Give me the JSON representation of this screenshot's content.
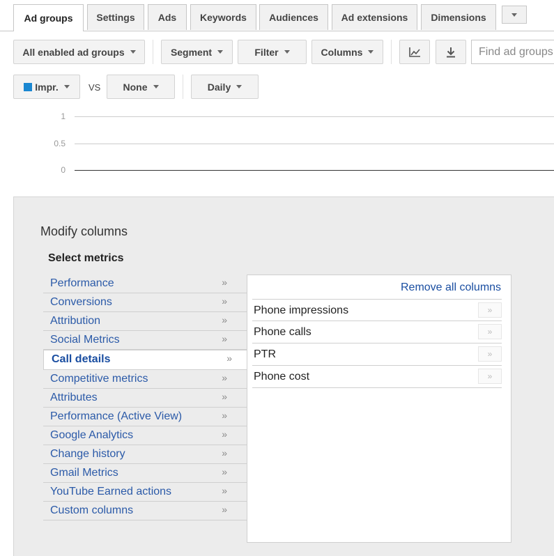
{
  "tabs": [
    {
      "label": "Ad groups",
      "active": true
    },
    {
      "label": "Settings"
    },
    {
      "label": "Ads"
    },
    {
      "label": "Keywords"
    },
    {
      "label": "Audiences"
    },
    {
      "label": "Ad extensions"
    },
    {
      "label": "Dimensions"
    }
  ],
  "toolbar": {
    "filter_status": "All enabled ad groups",
    "segment": "Segment",
    "filter": "Filter",
    "columns": "Columns",
    "chart_icon": "line-chart-icon",
    "download_icon": "download-icon",
    "search_placeholder": "Find ad groups"
  },
  "chart_controls": {
    "metric1": "Impr.",
    "metric1_color": "#1a87d1",
    "vs": "VS",
    "metric2": "None",
    "period": "Daily"
  },
  "chart_data": {
    "type": "line",
    "y_ticks": [
      "1",
      "0.5",
      "0"
    ],
    "ylim": [
      0,
      1
    ],
    "series": [
      {
        "values": []
      }
    ]
  },
  "panel": {
    "title": "Modify columns",
    "select_metrics": "Select metrics",
    "categories": [
      {
        "label": "Performance"
      },
      {
        "label": "Conversions"
      },
      {
        "label": "Attribution"
      },
      {
        "label": "Social Metrics"
      },
      {
        "label": "Call details",
        "selected": true
      },
      {
        "label": "Competitive metrics"
      },
      {
        "label": "Attributes"
      },
      {
        "label": "Performance (Active View)"
      },
      {
        "label": "Google Analytics"
      },
      {
        "label": "Change history"
      },
      {
        "label": "Gmail Metrics"
      },
      {
        "label": "YouTube Earned actions"
      },
      {
        "label": "Custom columns"
      }
    ],
    "chevron": "»",
    "remove_all": "Remove all columns",
    "selected_columns": [
      {
        "label": "Phone impressions"
      },
      {
        "label": "Phone calls"
      },
      {
        "label": "PTR"
      },
      {
        "label": "Phone cost"
      }
    ]
  }
}
